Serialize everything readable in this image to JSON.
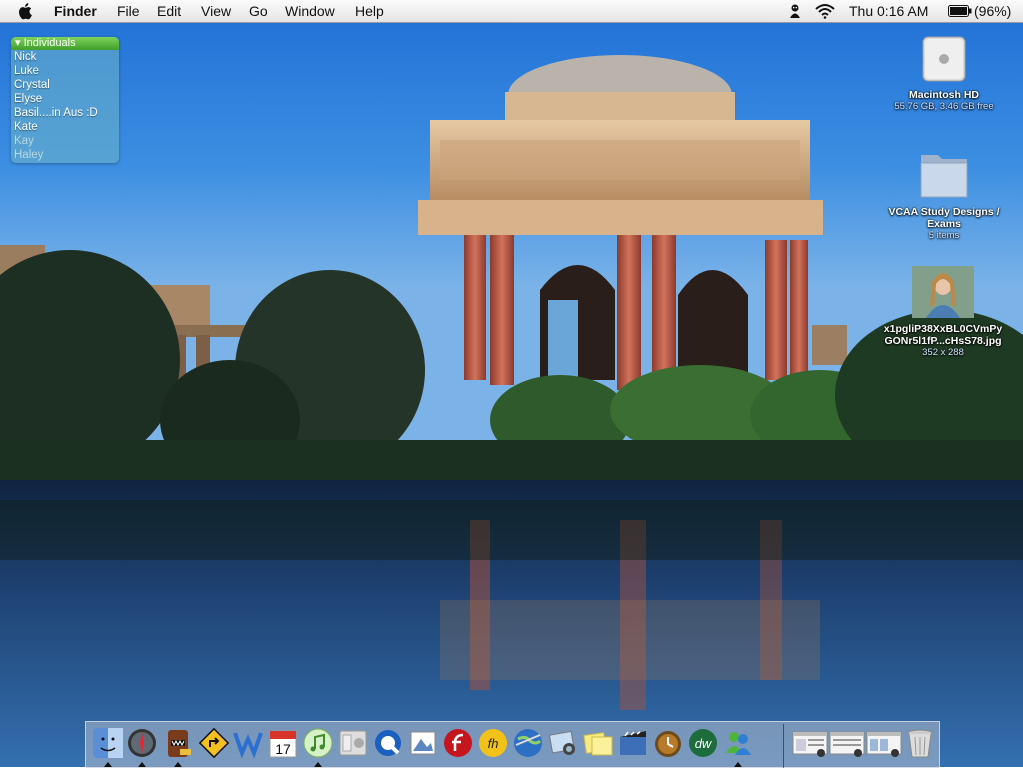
{
  "menubar": {
    "app_name": "Finder",
    "menus": [
      "File",
      "Edit",
      "View",
      "Go",
      "Window",
      "Help"
    ],
    "clock": "Thu 0:16 AM",
    "battery": "(96%)"
  },
  "buddy_list": {
    "group": "Individuals",
    "buddies": [
      {
        "name": "Nick",
        "idle": false
      },
      {
        "name": "Luke",
        "idle": false
      },
      {
        "name": "Crystal",
        "idle": false
      },
      {
        "name": "Elyse",
        "idle": false
      },
      {
        "name": "Basil....in Aus :D",
        "idle": false
      },
      {
        "name": "Kate",
        "idle": false
      },
      {
        "name": "Kay",
        "idle": true
      },
      {
        "name": "Haley",
        "idle": true
      }
    ]
  },
  "desktop_icons": [
    {
      "name": "Macintosh HD",
      "sub": "55.76 GB, 3.46 GB free",
      "icon": "hard-drive-icon"
    },
    {
      "name": "VCAA Study Designs / Exams",
      "name_line1": "VCAA Study Designs /",
      "name_line2": "Exams",
      "sub": "5 items",
      "icon": "folder-icon"
    },
    {
      "name": "x1pgliP38XxBL0CVmPyGONr5l1fP...cHsS78.jpg",
      "name_line1": "x1pgliP38XxBL0CVmPy",
      "name_line2": "GONr5l1fP...cHsS78.jpg",
      "sub": "352 x 288",
      "icon": "photo-thumbnail-icon"
    }
  ],
  "dock": {
    "apps": [
      {
        "name": "Finder",
        "icon": "finder-icon",
        "running": true
      },
      {
        "name": "Dashboard",
        "icon": "dashboard-icon",
        "running": true
      },
      {
        "name": "Domo",
        "icon": "domo-icon",
        "running": true
      },
      {
        "name": "Road Sign",
        "icon": "road-sign-icon",
        "running": false
      },
      {
        "name": "Word",
        "icon": "word-icon",
        "running": false
      },
      {
        "name": "iCal",
        "icon": "ical-icon",
        "running": false
      },
      {
        "name": "iTunes",
        "icon": "itunes-icon",
        "running": true
      },
      {
        "name": "System Preferences",
        "icon": "system-preferences-icon",
        "running": false
      },
      {
        "name": "QuickTime",
        "icon": "quicktime-icon",
        "running": false
      },
      {
        "name": "Preview",
        "icon": "preview-icon",
        "running": false
      },
      {
        "name": "Flash",
        "icon": "flash-icon",
        "running": false
      },
      {
        "name": "FreeHand",
        "icon": "freehand-icon",
        "running": false
      },
      {
        "name": "Google Earth",
        "icon": "google-earth-icon",
        "running": false
      },
      {
        "name": "iPhoto",
        "icon": "iphoto-icon",
        "running": false
      },
      {
        "name": "Stickies",
        "icon": "stickies-icon",
        "running": false
      },
      {
        "name": "iMovie",
        "icon": "imovie-icon",
        "running": false
      },
      {
        "name": "Reminder",
        "icon": "reminder-icon",
        "running": false
      },
      {
        "name": "Dreamweaver",
        "icon": "dreamweaver-icon",
        "running": false
      },
      {
        "name": "Messenger",
        "icon": "messenger-icon",
        "running": true
      }
    ],
    "docs": [
      {
        "name": "Minimized Window 1",
        "icon": "minimized-window-icon"
      },
      {
        "name": "Minimized Window 2",
        "icon": "minimized-window-icon"
      },
      {
        "name": "Minimized Window 3",
        "icon": "minimized-window-icon"
      },
      {
        "name": "Trash",
        "icon": "trash-icon"
      }
    ]
  },
  "colors": {
    "sky": "#3a8fe0",
    "water": "#2c5f99",
    "buddy_header": "#4aae33"
  }
}
